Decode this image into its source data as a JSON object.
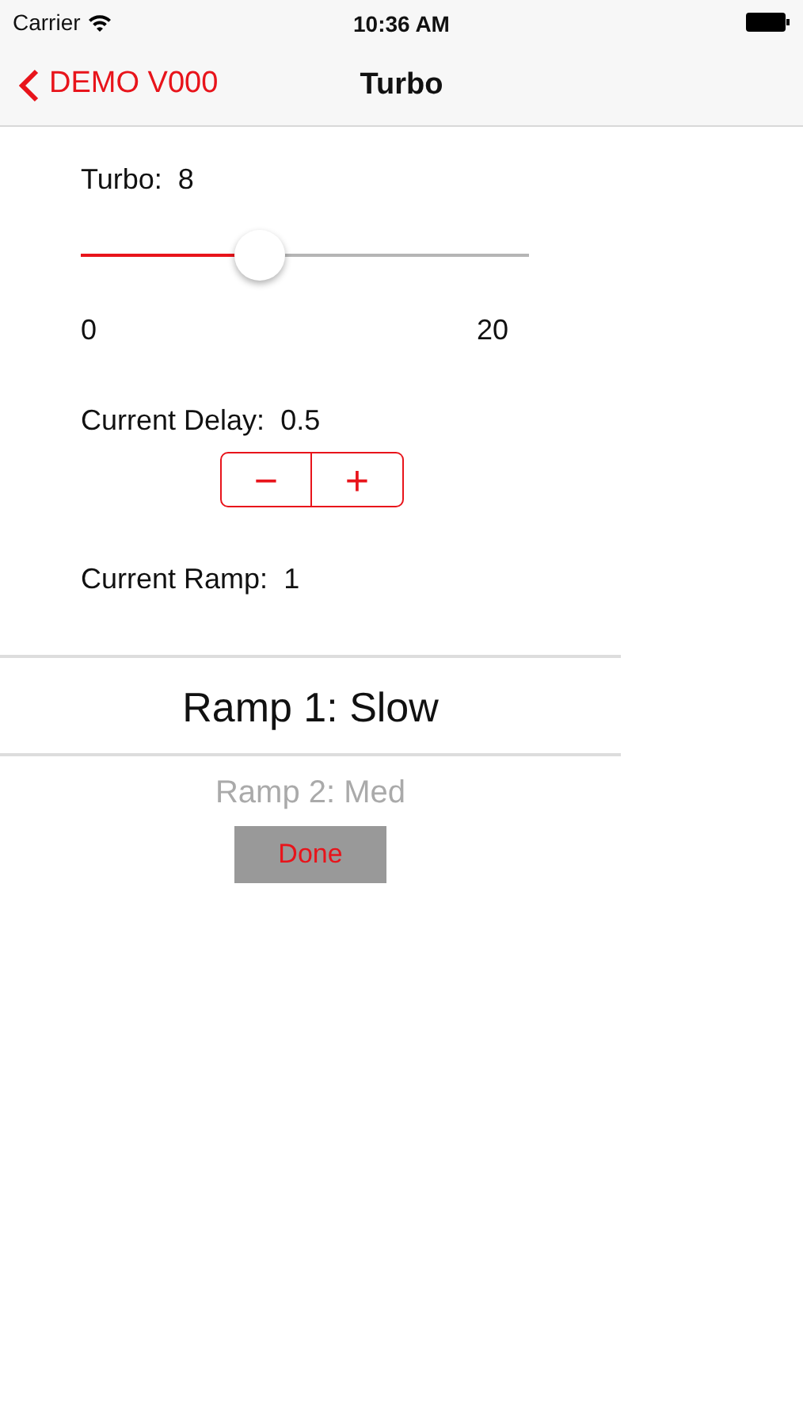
{
  "status_bar": {
    "carrier": "Carrier",
    "time": "10:36 AM"
  },
  "nav_bar": {
    "back_label": "DEMO V000",
    "title": "Turbo"
  },
  "turbo": {
    "label": "Turbo:",
    "value": "8",
    "level": 0.4,
    "min_label": "0",
    "max_label": "20"
  },
  "delay": {
    "label": "Current Delay:",
    "value": "0.5",
    "stepper": [
      "−",
      "+"
    ]
  },
  "ramp": {
    "label": "Current Ramp:",
    "value": "1"
  },
  "picker": [
    {
      "label": "Ramp 1: Slow",
      "selected": true
    },
    {
      "label": "Ramp 2: Med",
      "selected": false
    }
  ],
  "done_button": "Done"
}
